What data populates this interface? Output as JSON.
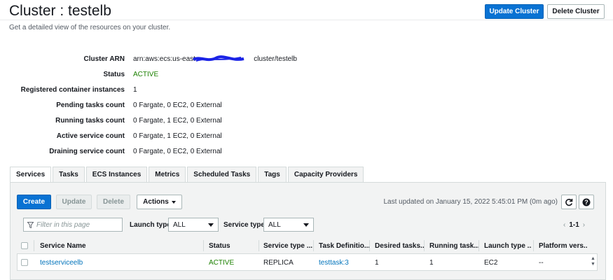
{
  "header": {
    "title": "Cluster : testelb",
    "subtitle": "Get a detailed view of the resources on your cluster.",
    "update_label": "Update Cluster",
    "delete_label": "Delete Cluster"
  },
  "details": {
    "arn_label": "Cluster ARN",
    "arn_prefix": "arn:aws:ecs:us-east-",
    "arn_suffix": "cluster/testelb",
    "status_label": "Status",
    "status_value": "ACTIVE",
    "instances_label": "Registered container instances",
    "instances_value": "1",
    "pending_label": "Pending tasks count",
    "pending_value": "0 Fargate, 0 EC2, 0 External",
    "running_label": "Running tasks count",
    "running_value": "0 Fargate, 1 EC2, 0 External",
    "active_label": "Active service count",
    "active_value": "0 Fargate, 1 EC2, 0 External",
    "draining_label": "Draining service count",
    "draining_value": "0 Fargate, 0 EC2, 0 External"
  },
  "tabs": [
    "Services",
    "Tasks",
    "ECS Instances",
    "Metrics",
    "Scheduled Tasks",
    "Tags",
    "Capacity Providers"
  ],
  "toolbar": {
    "create": "Create",
    "update": "Update",
    "delete": "Delete",
    "actions": "Actions",
    "last_updated": "Last updated on January 15, 2022 5:45:01 PM (0m ago)",
    "refresh_icon": "refresh-icon",
    "help_icon": "help-icon"
  },
  "filters": {
    "placeholder": "Filter in this page",
    "launch_type_label": "Launch type",
    "launch_type_value": "ALL",
    "service_type_label": "Service type",
    "service_type_value": "ALL",
    "pager": "1-1"
  },
  "table": {
    "columns": [
      "Service Name",
      "Status",
      "Service type ...",
      "Task Definitio...",
      "Desired tasks...",
      "Running task...",
      "Launch type ...",
      "Platform vers..."
    ],
    "row": {
      "service_name": "testserviceelb",
      "status": "ACTIVE",
      "service_type": "REPLICA",
      "task_definition": "testtask:3",
      "desired": "1",
      "running": "1",
      "launch_type": "EC2",
      "platform": "--"
    }
  },
  "colors": {
    "primary": "#0972d3",
    "active": "#1d8102",
    "link": "#0073bb"
  }
}
